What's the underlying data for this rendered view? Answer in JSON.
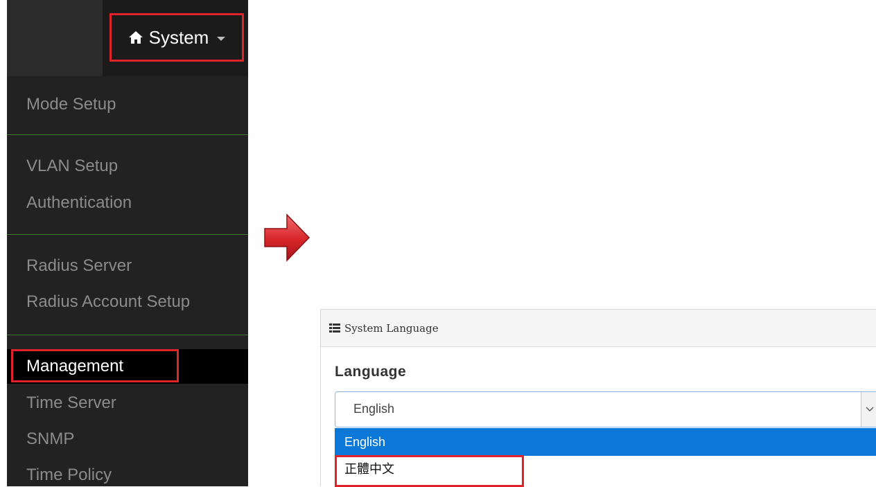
{
  "nav": {
    "system_label": "System",
    "menu_items": [
      "Mode Setup",
      "VLAN Setup",
      "Authentication",
      "Radius Server",
      "Radius Account Setup",
      "Management",
      "Time Server",
      "SNMP",
      "Time Policy"
    ]
  },
  "panel": {
    "title": "System Language",
    "language_label": "Language",
    "selected_value": "English",
    "options": [
      "English",
      "正體中文"
    ]
  },
  "colors": {
    "highlight_red": "#e0232b",
    "selected_blue": "#0b78d7",
    "menu_bg": "#222222",
    "divider_green": "#3e7a2e"
  },
  "icons": [
    "home-icon",
    "caret-down-icon",
    "arrow-right-icon",
    "list-icon",
    "chevron-down-icon"
  ]
}
